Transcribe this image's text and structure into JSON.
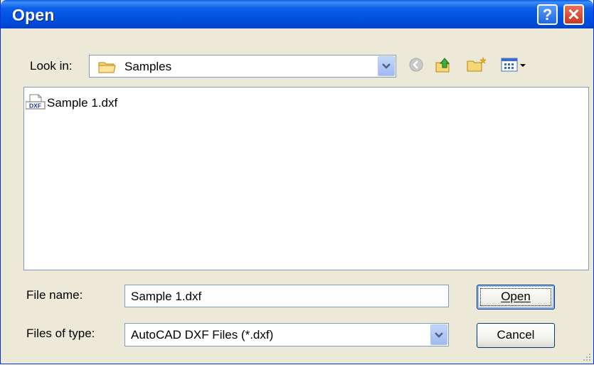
{
  "window": {
    "title": "Open"
  },
  "titlebar": {
    "help_label": "?",
    "close_label": "✕"
  },
  "look_in": {
    "label": "Look in:",
    "value": "Samples",
    "icon": "folder-icon"
  },
  "toolbar": {
    "icons": [
      "back-icon",
      "up-folder-icon",
      "new-folder-icon",
      "view-menu-icon"
    ]
  },
  "files": [
    {
      "name": "Sample 1.dxf",
      "icon": "dxf-file-icon",
      "icon_text": "DXF"
    }
  ],
  "file_name": {
    "label": "File name:",
    "value": "Sample 1.dxf"
  },
  "file_type": {
    "label": "Files of type:",
    "value": "AutoCAD DXF Files (*.dxf)"
  },
  "buttons": {
    "open": "Open",
    "cancel": "Cancel"
  },
  "colors": {
    "title_bar": "#0054e3",
    "dialog_bg": "#ece9d8",
    "border": "#7f9db9"
  }
}
